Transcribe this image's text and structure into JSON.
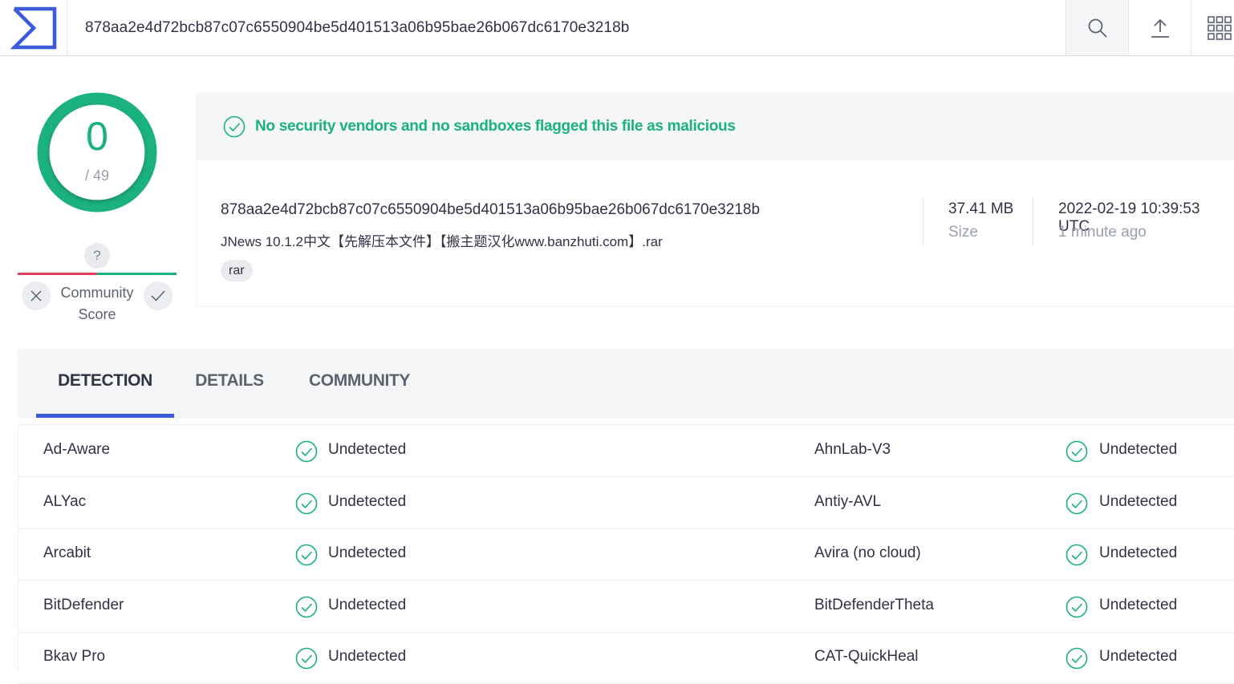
{
  "header": {
    "search_value": "878aa2e4d72bcb87c07c6550904be5d401513a06b95bae26b067dc6170e3218b"
  },
  "score": {
    "detections": "0",
    "total": "/ 49",
    "color": "#1bb180"
  },
  "community": {
    "question": "?",
    "label_line1": "Community",
    "label_line2": "Score"
  },
  "verdict": {
    "text": "No security vendors and no sandboxes flagged this file as malicious"
  },
  "file": {
    "hash": "878aa2e4d72bcb87c07c6550904be5d401513a06b95bae26b067dc6170e3218b",
    "name": "JNews 10.1.2中文【先解压本文件】【搬主题汉化www.banzhuti.com】.rar",
    "tag": "rar",
    "size_value": "37.41 MB",
    "size_label": "Size",
    "date_value": "2022-02-19 10:39:53 UTC",
    "date_label": "1 minute ago"
  },
  "tabs": [
    {
      "label": "DETECTION"
    },
    {
      "label": "DETAILS"
    },
    {
      "label": "COMMUNITY"
    }
  ],
  "detections": [
    {
      "left_vendor": "Ad-Aware",
      "left_result": "Undetected",
      "right_vendor": "AhnLab-V3",
      "right_result": "Undetected"
    },
    {
      "left_vendor": "ALYac",
      "left_result": "Undetected",
      "right_vendor": "Antiy-AVL",
      "right_result": "Undetected"
    },
    {
      "left_vendor": "Arcabit",
      "left_result": "Undetected",
      "right_vendor": "Avira (no cloud)",
      "right_result": "Undetected"
    },
    {
      "left_vendor": "BitDefender",
      "left_result": "Undetected",
      "right_vendor": "BitDefenderTheta",
      "right_result": "Undetected"
    },
    {
      "left_vendor": "Bkav Pro",
      "left_result": "Undetected",
      "right_vendor": "CAT-QuickHeal",
      "right_result": "Undetected"
    }
  ],
  "colors": {
    "accent": "#3b5bdb",
    "clean": "#1bb180",
    "malicious": "#e4405f"
  }
}
